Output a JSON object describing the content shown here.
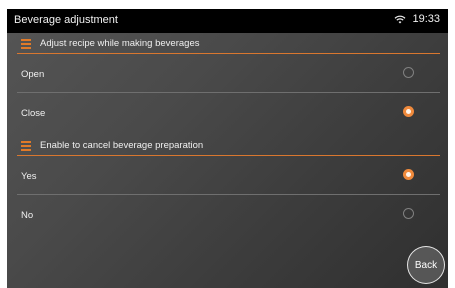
{
  "header": {
    "title": "Beverage adjustment",
    "time": "19:33",
    "wifi_icon": "wifi-icon"
  },
  "sections": [
    {
      "label": "Adjust recipe while making beverages",
      "options": [
        {
          "label": "Open",
          "selected": false
        },
        {
          "label": "Close",
          "selected": true
        }
      ]
    },
    {
      "label": "Enable to cancel beverage preparation",
      "options": [
        {
          "label": "Yes",
          "selected": true
        },
        {
          "label": "No",
          "selected": false
        }
      ]
    }
  ],
  "footer": {
    "back_label": "Back"
  },
  "colors": {
    "accent": "#d9772f",
    "radio_selected": "#f08a3c",
    "statusbar": "#000000"
  }
}
